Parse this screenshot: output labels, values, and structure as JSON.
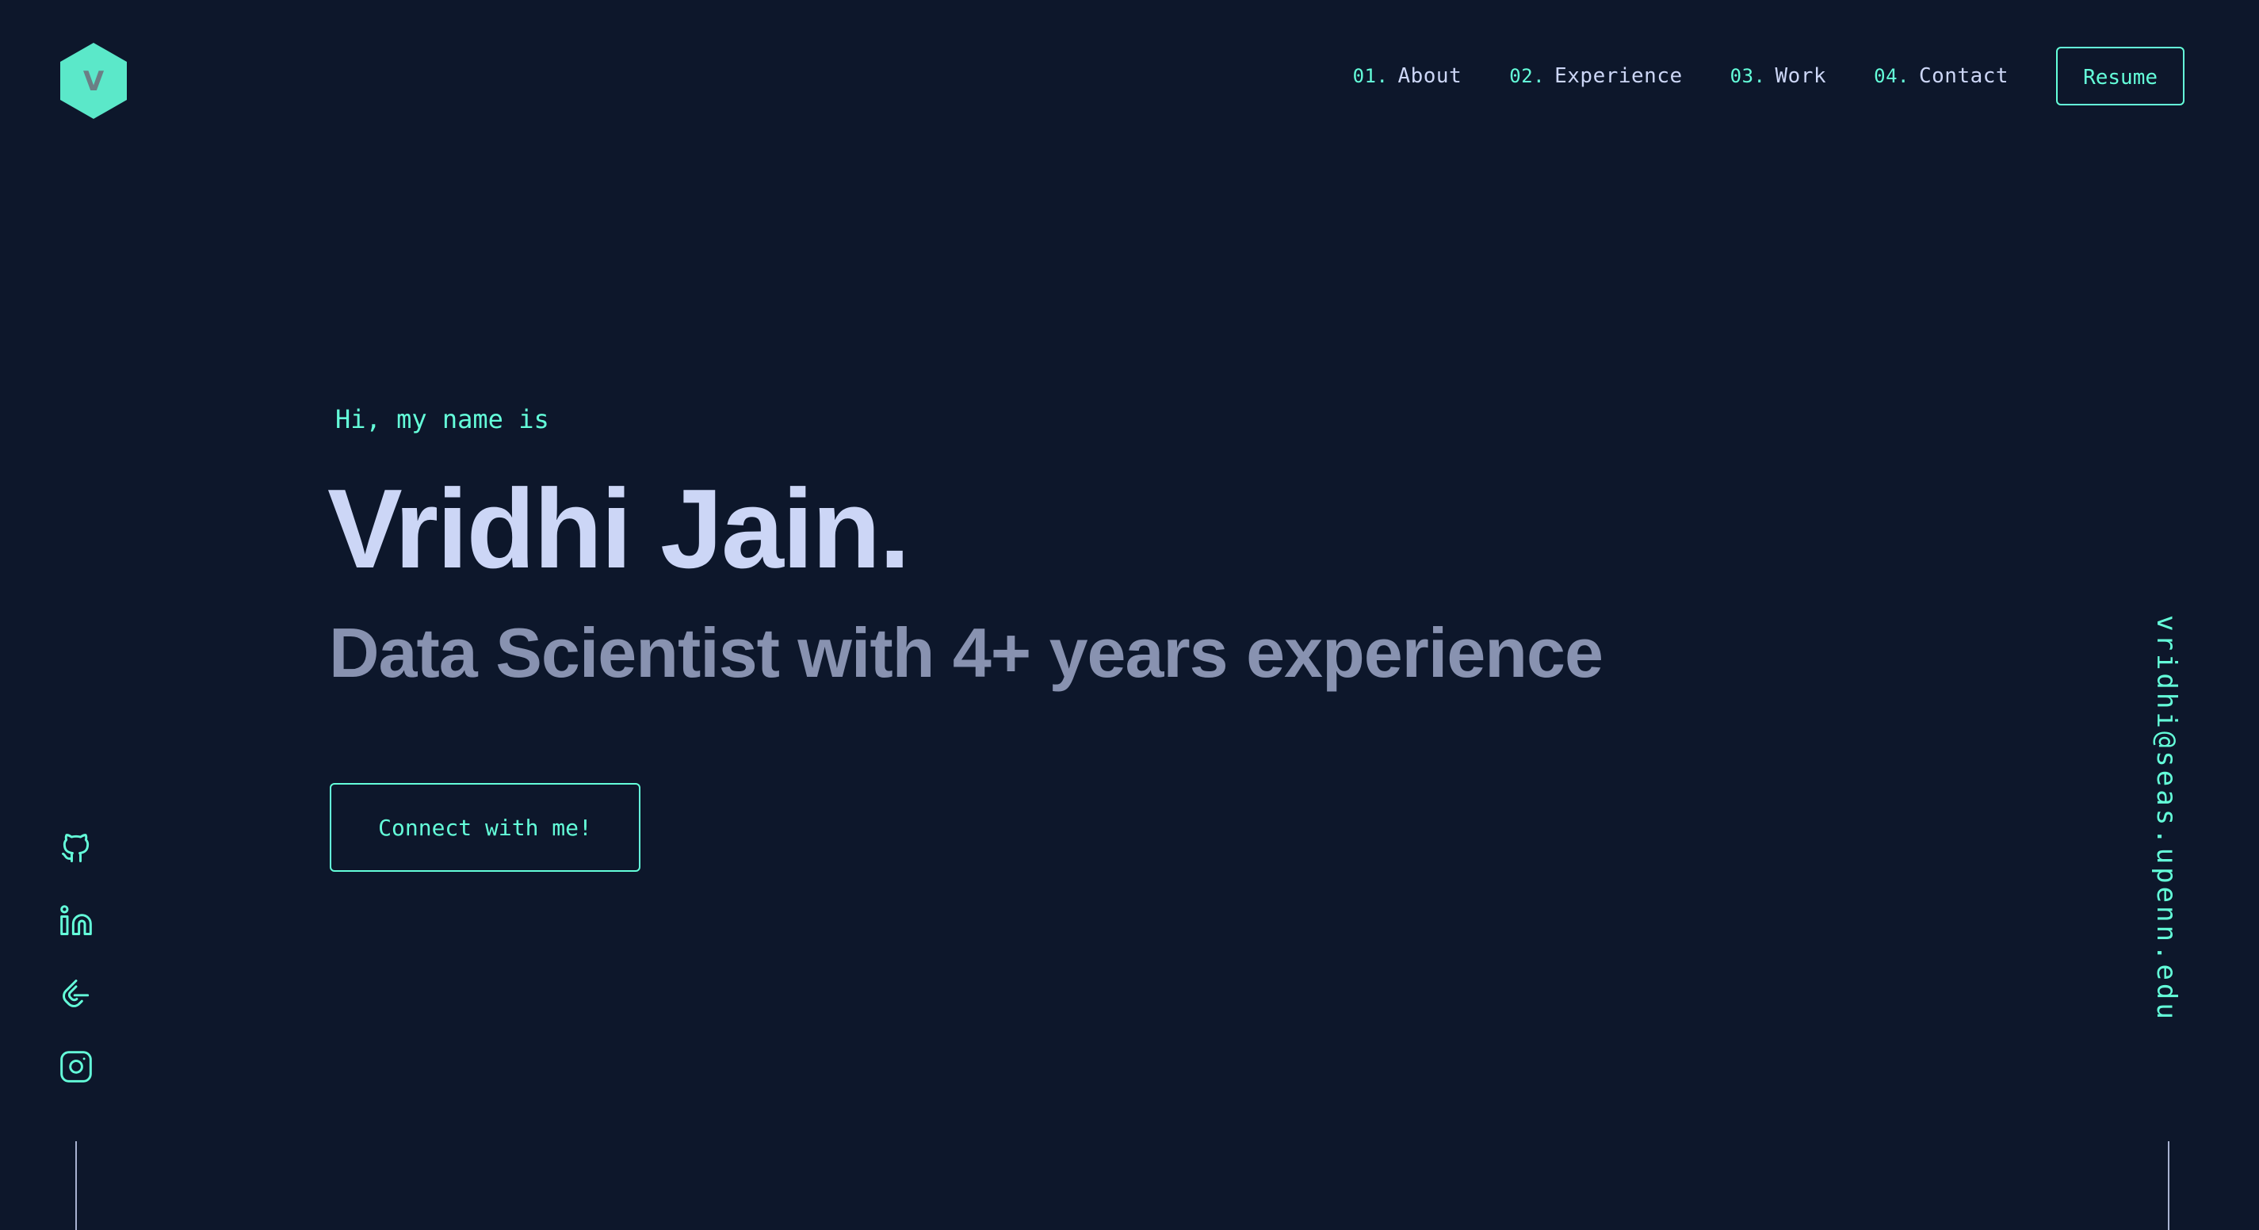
{
  "logo": {
    "letter": "V"
  },
  "nav": {
    "items": [
      {
        "num": "01.",
        "label": "About"
      },
      {
        "num": "02.",
        "label": "Experience"
      },
      {
        "num": "03.",
        "label": "Work"
      },
      {
        "num": "04.",
        "label": "Contact"
      }
    ],
    "resume_label": "Resume"
  },
  "hero": {
    "greeting": "Hi, my name is",
    "name": "Vridhi Jain.",
    "tagline": "Data Scientist with 4+ years experience",
    "cta_label": "Connect with me!"
  },
  "socials": [
    {
      "icon": "github-icon"
    },
    {
      "icon": "linkedin-icon"
    },
    {
      "icon": "gitlab-icon"
    },
    {
      "icon": "instagram-icon"
    }
  ],
  "email": "vridhi@seas.upenn.edu",
  "colors": {
    "background": "#0d172b",
    "accent": "#64ffda",
    "heading": "#ccd6f6",
    "subheading": "#8892b0"
  }
}
